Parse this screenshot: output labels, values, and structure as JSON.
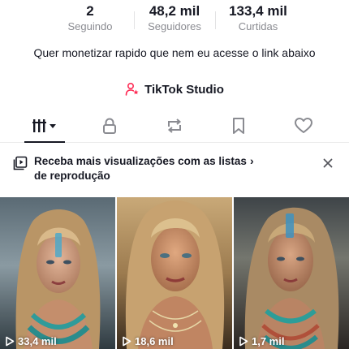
{
  "stats": [
    {
      "value": "2",
      "label": "Seguindo"
    },
    {
      "value": "48,2 mil",
      "label": "Seguidores"
    },
    {
      "value": "133,4 mil",
      "label": "Curtidas"
    }
  ],
  "bio": "Quer monetizar rapido que nem eu acesse o link abaixo",
  "studio": {
    "label": "TikTok Studio",
    "icon": "person-star-icon"
  },
  "tabs": [
    {
      "icon": "videos-grid-icon",
      "active": true
    },
    {
      "icon": "lock-icon"
    },
    {
      "icon": "repost-icon"
    },
    {
      "icon": "bookmark-icon"
    },
    {
      "icon": "heart-icon"
    }
  ],
  "banner": {
    "text": "Receba mais visualizações com as listas de reprodução",
    "chevron": "›",
    "icon": "playlist-icon"
  },
  "videos": [
    {
      "views": "33,4 mil"
    },
    {
      "views": "18,6 mil"
    },
    {
      "views": "1,7 mil"
    }
  ],
  "colors": {
    "text": "#161823",
    "muted": "#8a8b91",
    "accent": "#fe2c55"
  }
}
